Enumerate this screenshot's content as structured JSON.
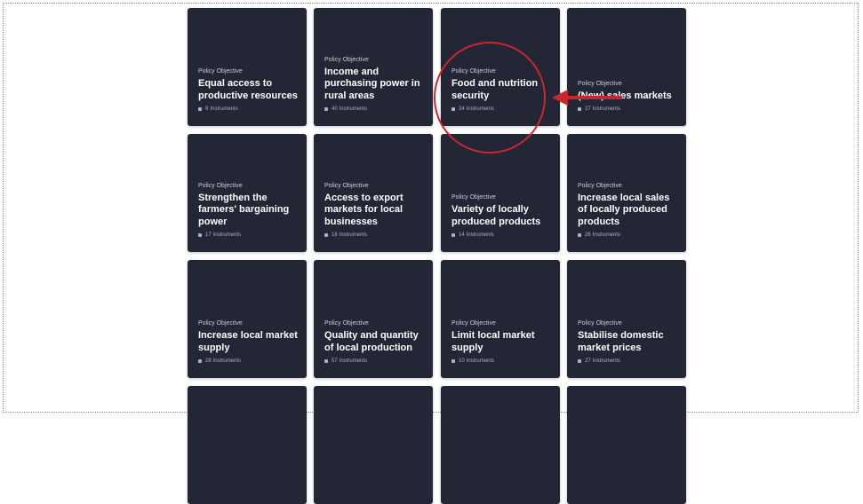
{
  "cards": [
    {
      "eyebrow": "Policy Objective",
      "title": "Equal access to productive resources",
      "count": "9",
      "unit": "Instruments"
    },
    {
      "eyebrow": "Policy Objective",
      "title": "Income and purchasing power in rural areas",
      "count": "40",
      "unit": "Instruments"
    },
    {
      "eyebrow": "Policy Objective",
      "title": "Food and nutrition security",
      "count": "34",
      "unit": "Instruments"
    },
    {
      "eyebrow": "Policy Objective",
      "title": "(New) sales markets",
      "count": "27",
      "unit": "Instruments"
    },
    {
      "eyebrow": "Policy Objective",
      "title": "Strengthen the farmers' bargaining power",
      "count": "17",
      "unit": "Instruments"
    },
    {
      "eyebrow": "Policy Objective",
      "title": "Access to export markets for local businesses",
      "count": "18",
      "unit": "Instruments"
    },
    {
      "eyebrow": "Policy Objective",
      "title": "Variety of locally produced products",
      "count": "14",
      "unit": "Instruments"
    },
    {
      "eyebrow": "Policy Objective",
      "title": "Increase local sales of locally produced products",
      "count": "26",
      "unit": "Instruments"
    },
    {
      "eyebrow": "Policy Objective",
      "title": "Increase local market supply",
      "count": "28",
      "unit": "Instruments"
    },
    {
      "eyebrow": "Policy Objective",
      "title": "Quality and quantity of local production",
      "count": "57",
      "unit": "Instruments"
    },
    {
      "eyebrow": "Policy Objective",
      "title": "Limit local market supply",
      "count": "10",
      "unit": "Instruments"
    },
    {
      "eyebrow": "Policy Objective",
      "title": "Stabilise domestic market prices",
      "count": "27",
      "unit": "Instruments"
    }
  ],
  "colors": {
    "card_background": "#222635",
    "annotation": "#c8282d"
  }
}
